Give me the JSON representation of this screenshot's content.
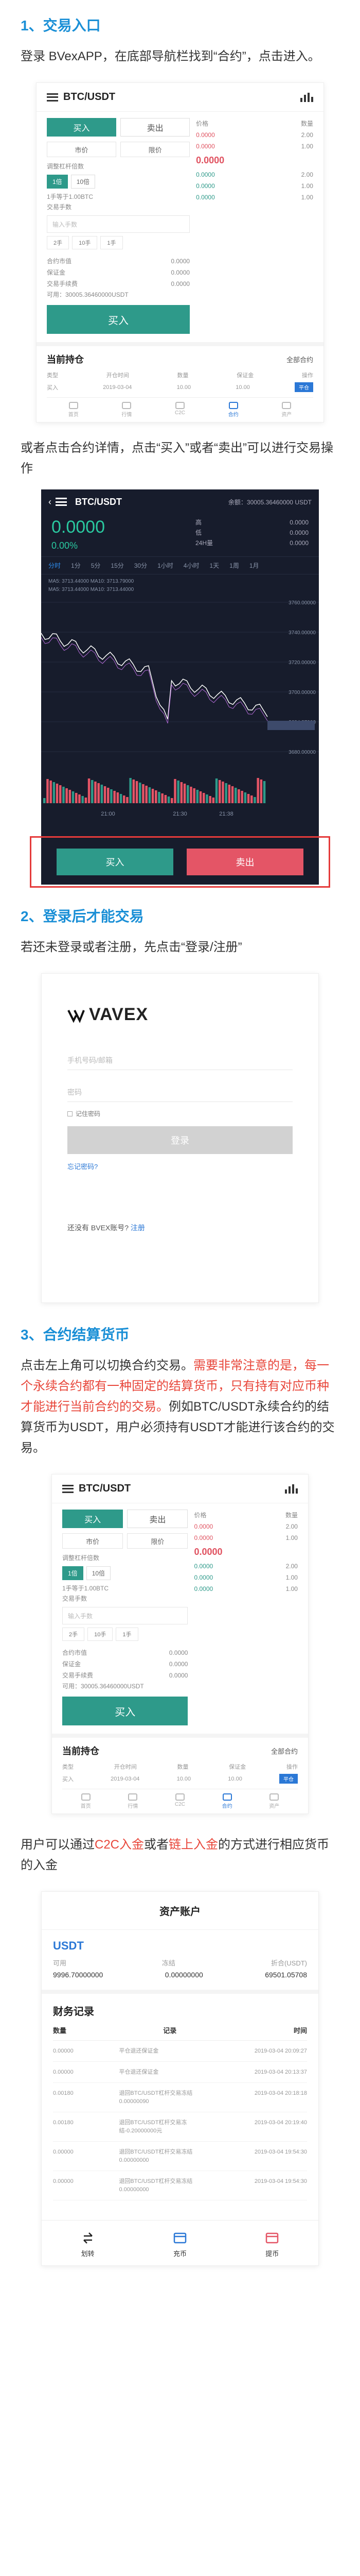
{
  "s1": {
    "title": "1、交易入口",
    "p1": "登录 BVexAPP，在底部导航栏找到“合约”，点击进入。",
    "p2": "或者点击合约详情，点击“买入”或者“卖出”可以进行交易操作"
  },
  "s2": {
    "title": "2、登录后才能交易",
    "p1": "若还未登录或者注册，先点击“登录/注册”"
  },
  "s3": {
    "title": "3、合约结算货币",
    "p_black1": "点击左上角可以切换合约交易。",
    "p_red": "需要非常注意的是，每一个永续合约都有一种固定的结算货币，只有持有对应币种才能进行当前合约的交易。",
    "p_black2": "例如BTC/USDT永续合约的结算货币为USDT，用户必须持有USDT才能进行该合约的交易。",
    "p2_a": "用户可以通过",
    "p2_link1": "C2C入金",
    "p2_b": "或者",
    "p2_link2": "链上入金",
    "p2_c": "的方式进行相应货币的入金"
  },
  "trade": {
    "pair": "BTC/USDT",
    "buy": "买入",
    "sell": "卖出",
    "limit": "市价",
    "market": "限价",
    "available_label": "调整杠杆倍数",
    "lev1": "1倍",
    "lev2": "10倍",
    "min_note": "1手等于1.00BTC",
    "qty_label": "交易手数",
    "qty_placeholder": "输入手数",
    "m1": "2手",
    "m2": "10手",
    "m3": "1手",
    "r1_label": "合约市值",
    "r1_val": "0.0000",
    "r2_label": "保证金",
    "r2_val": "0.0000",
    "r3_label": "交易手续费",
    "r3_val": "0.0000",
    "avail": "可用：30005.36460000USDT",
    "big_buy": "买入",
    "ob_price_h": "价格",
    "ob_qty_h": "数量",
    "ob_mid": "0.0000",
    "pos_title": "当前持仓",
    "pos_all": "全部合约",
    "pos_cols": [
      "类型",
      "开仓时间",
      "数量",
      "保证金",
      "操作"
    ],
    "pos_vals": [
      "买入",
      "2019-03-04",
      "10.00",
      "10.00",
      "平仓"
    ],
    "tabs": [
      "首页",
      "行情",
      "C2C",
      "合约",
      "资产"
    ]
  },
  "dark": {
    "pair": "BTC/USDT",
    "right": "余额：30005.36460000 USDT",
    "price": "0.0000",
    "pct": "0.00%",
    "side": [
      [
        "高",
        "0.0000"
      ],
      [
        "低",
        "0.0000"
      ],
      [
        "24H量",
        "0.0000"
      ]
    ],
    "tabs": [
      "分时",
      "1分",
      "5分",
      "15分",
      "30分",
      "1小时",
      "4小时",
      "1天",
      "1周",
      "1月"
    ],
    "ma1": "MA5: 3713.44000  MA10: 3713.79000",
    "ma2": "MA5: 3713.44000  MA10: 3713.44000",
    "yticks": [
      "3760.00000",
      "3740.00000",
      "3720.00000",
      "3700.00000",
      "3684.37000",
      "3680.00000"
    ],
    "xticks": [
      "21:00",
      "21:30",
      "21:38"
    ],
    "buy": "买入",
    "sell": "卖出"
  },
  "login": {
    "brand": "VAVEX",
    "phone": "手机号码/邮箱",
    "pwd": "密码",
    "remember": "记住密码",
    "btn": "登录",
    "forgot": "忘记密码?",
    "reg_text": "还没有 BVEX账号?",
    "reg_link": "注册"
  },
  "asset": {
    "top": "资产账户",
    "coin": "USDT",
    "h": [
      "可用",
      "冻结",
      "折合(USDT)"
    ],
    "v": [
      "9996.70000000",
      "0.00000000",
      "69501.05708"
    ],
    "rec_title": "财务记录",
    "th": [
      "数量",
      "记录",
      "时间"
    ],
    "rows": [
      [
        "0.00000",
        "平仓退还保证金",
        "2019-03-04 20:09:27"
      ],
      [
        "0.00000",
        "平仓退还保证金",
        "2019-03-04 20:13:37"
      ],
      [
        "0.00180",
        "退回BTC/USDT杠杆交易冻结0.00000090",
        "2019-03-04 20:18:18"
      ],
      [
        "0.00180",
        "退回BTC/USDT杠杆交易冻结-0.20000000元",
        "2019-03-04 20:19:40"
      ],
      [
        "0.00000",
        "退回BTC/USDT杠杆交易冻结0.00000000",
        "2019-03-04 19:54:30"
      ],
      [
        "0.00000",
        "退回BTC/USDT杠杆交易冻结0.00000000",
        "2019-03-04 19:54:30"
      ]
    ],
    "tab1": "划转",
    "tab2": "充币",
    "tab3": "提币"
  },
  "chart_data": {
    "type": "line",
    "x": [
      "21:00",
      "21:30",
      "21:38"
    ],
    "ylim": [
      3670,
      3770
    ],
    "volumes_color": "#e45566",
    "price_color": "#ffffff"
  }
}
